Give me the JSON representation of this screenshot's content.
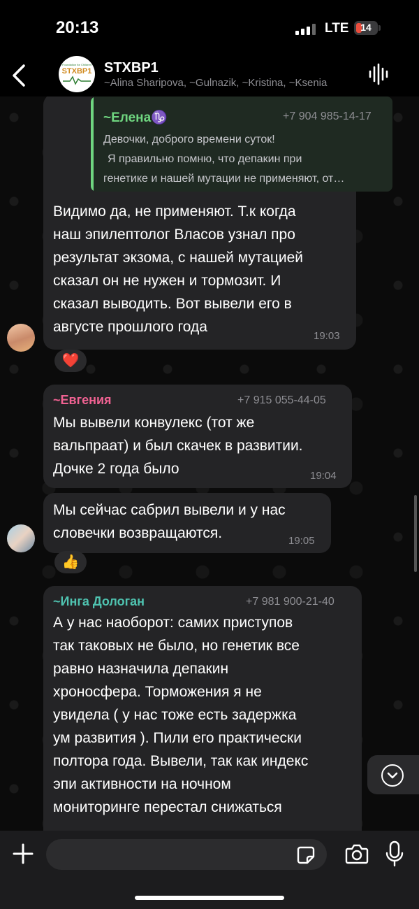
{
  "status_bar": {
    "time": "20:13",
    "network": "LTE",
    "battery": "14"
  },
  "header": {
    "title": "STXBP1",
    "members": "~Alina Sharipova, ~Gulnazik, ~Kristina, ~Ksenia",
    "logo_text": "STXBP1",
    "logo_small": "Foundation for Children"
  },
  "messages": [
    {
      "reply": {
        "sender": "~Елена♑",
        "phone": "+7 904 985-14-17",
        "lines": [
          "Девочки, доброго времени суток!",
          "Я правильно помню, что депакин при",
          "генетике и нашей мутации не применяют, от…"
        ]
      },
      "lines": [
        "Видимо да, не применяют. Т.к когда",
        "наш эпилептолог Власов узнал про",
        "результат экзома, с нашей мутацией",
        "сказал он не нужен и тормозит. И",
        "сказал выводить. Вот вывели его в",
        "августе прошлого года"
      ],
      "time": "19:03",
      "reaction": "❤️"
    },
    {
      "sender": "~Евгения",
      "sender_color": "#f06292",
      "phone": "+7 915 055-44-05",
      "lines": [
        "Мы вывели конвулекс (тот же",
        "вальпраат) и был скачек в развитии.",
        "Дочке 2 года было"
      ],
      "time": "19:04"
    },
    {
      "lines": [
        "Мы сейчас сабрил вывели и у нас",
        "словечки возвращаются."
      ],
      "time": "19:05",
      "reaction": "👍"
    },
    {
      "sender": "~Инга Дологан",
      "sender_color": "#4fc3b0",
      "phone": "+7 981 900-21-40",
      "lines": [
        "А у нас наоборот: самих приступов",
        "так таковых не было, но генетик все",
        "равно назначила депакин",
        "хроносфера.  Торможения я не",
        "увидела ( у нас тоже есть задержка",
        "ум развития ). Пили его практически",
        "полтора года. Вывели, так как  индекс",
        "эпи активности на ночном",
        "мониторинге перестал снижаться"
      ]
    }
  ],
  "input": {
    "placeholder": ""
  }
}
